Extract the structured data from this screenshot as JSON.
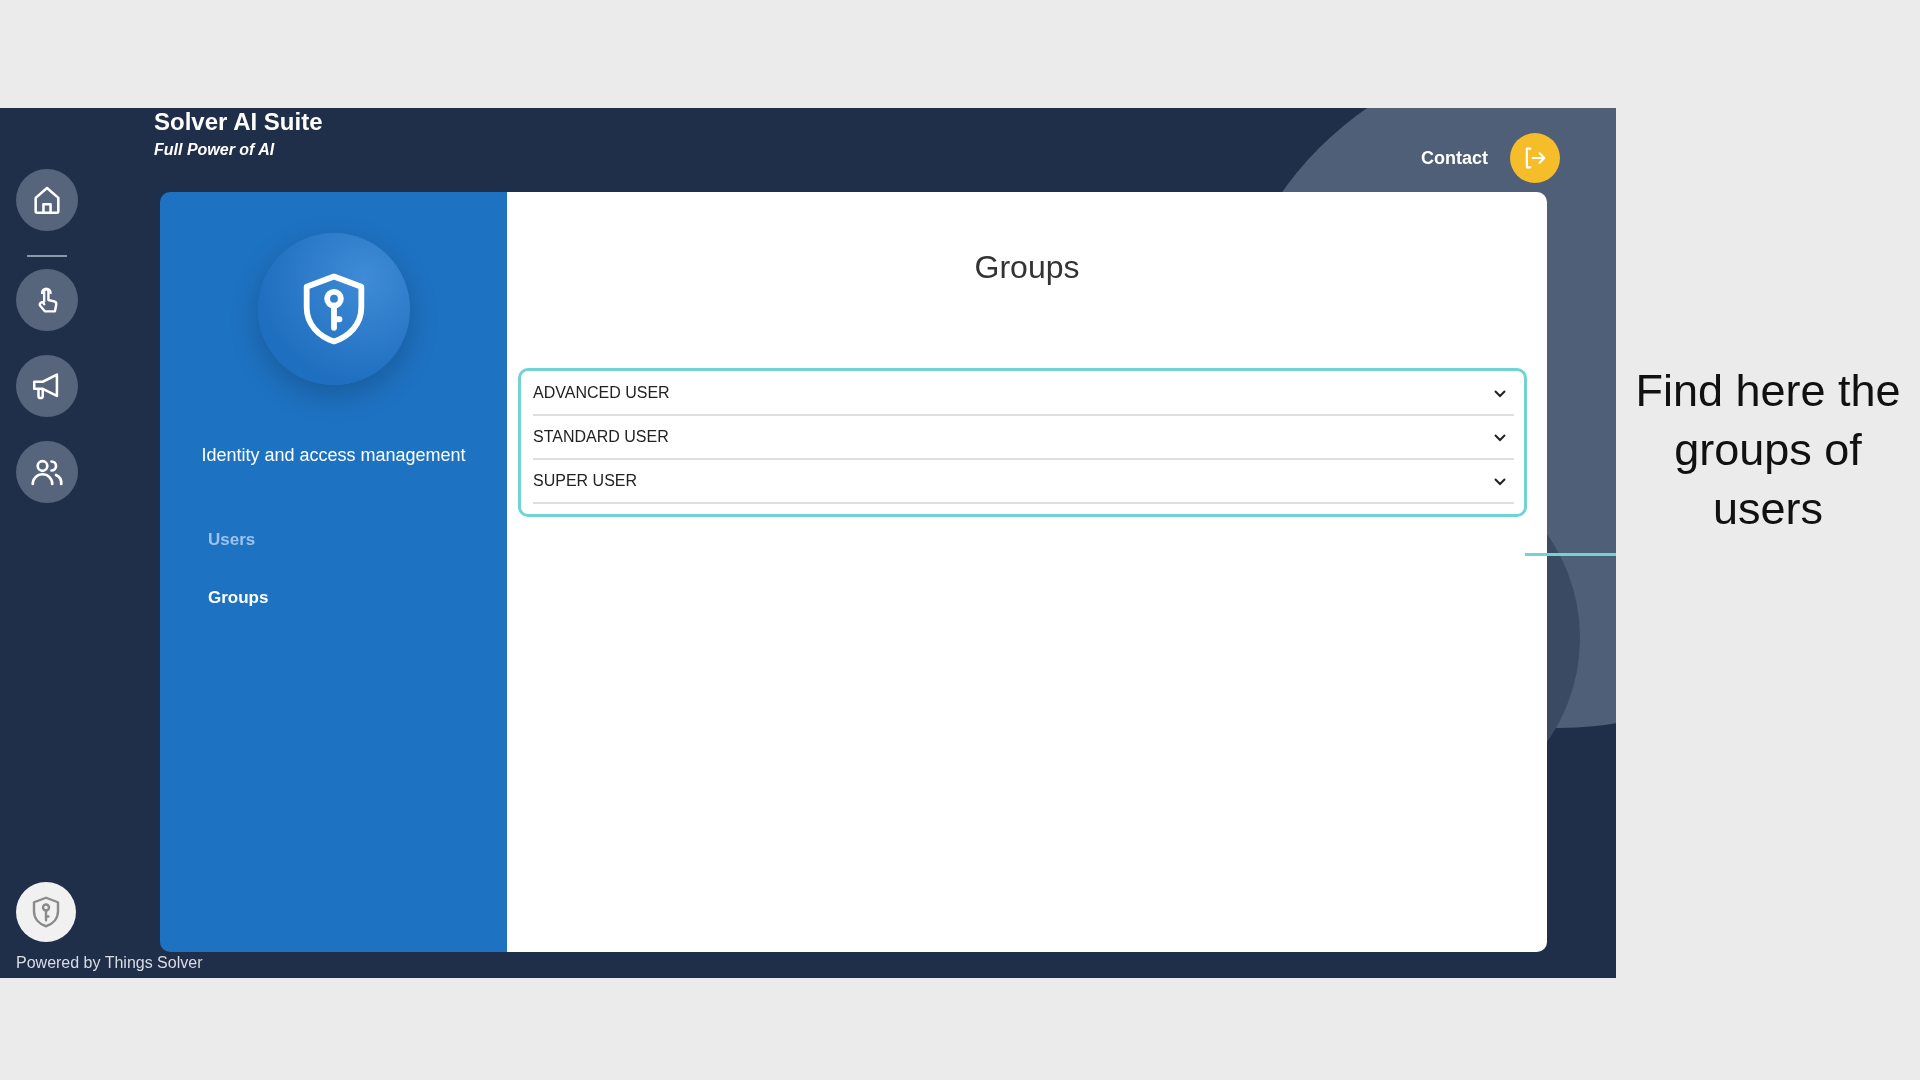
{
  "app": {
    "title": "Solver AI Suite",
    "subtitle": "Full Power of AI",
    "contact": "Contact",
    "footer": "Powered by Things Solver"
  },
  "module": {
    "title": "Identity and access management",
    "nav": [
      {
        "label": "Users",
        "selected": false
      },
      {
        "label": "Groups",
        "selected": true
      }
    ]
  },
  "page": {
    "heading": "Groups",
    "groups": [
      {
        "label": "ADVANCED USER",
        "expanded": false
      },
      {
        "label": "STANDARD USER",
        "expanded": false
      },
      {
        "label": "SUPER USER",
        "expanded": false
      }
    ]
  },
  "annotation": {
    "text": "Find here the groups of users"
  }
}
